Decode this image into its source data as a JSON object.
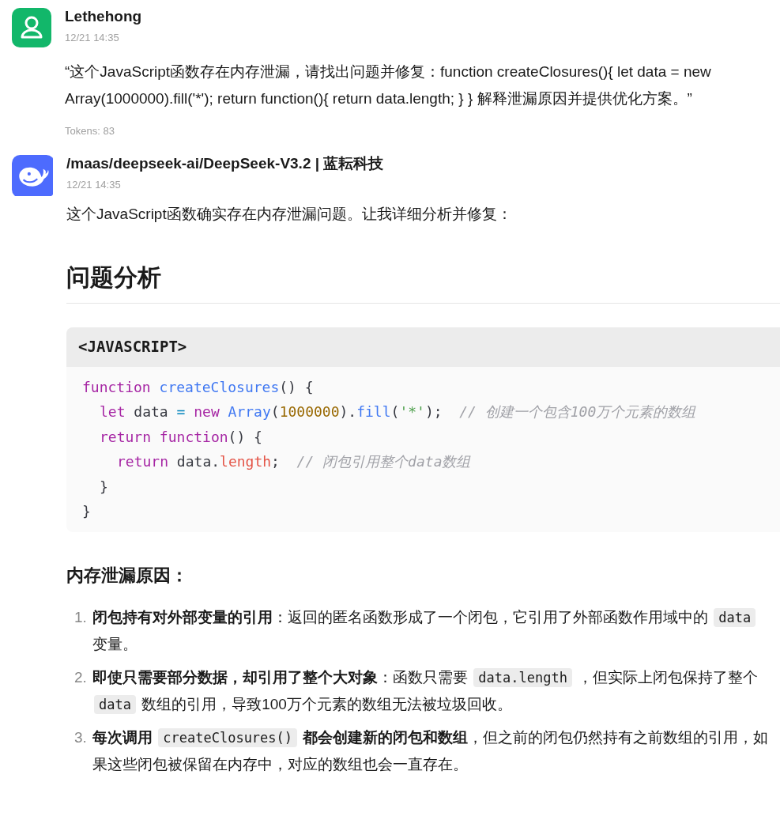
{
  "messages": [
    {
      "kind": "user",
      "author": "Lethehong",
      "time": "12/21 14:35",
      "text": "“这个JavaScript函数存在内存泄漏，请找出问题并修复：function createClosures(){ let data = new Array(1000000).fill('*'); return function(){ return data.length; } } 解释泄漏原因并提供优化方案。”",
      "tokens": "Tokens: 83"
    },
    {
      "kind": "bot",
      "author": "/maas/deepseek-ai/DeepSeek-V3.2 | 蓝耘科技",
      "time": "12/21 14:35",
      "intro": "这个JavaScript函数确实存在内存泄漏问题。让我详细分析并修复：",
      "heading": "问题分析",
      "code": {
        "language": "<JAVASCRIPT>",
        "lines": [
          {
            "tokens": [
              {
                "kind": "keyword",
                "text": "function"
              },
              {
                "kind": "func",
                "text": " createClosures"
              },
              {
                "kind": "plain",
                "text": "() {"
              }
            ],
            "children": [
              {
                "tokens": [
                  {
                    "kind": "keyword",
                    "text": "let"
                  },
                  {
                    "kind": "plain",
                    "text": " data "
                  },
                  {
                    "kind": "operator",
                    "text": "="
                  },
                  {
                    "kind": "keyword",
                    "text": " new"
                  },
                  {
                    "kind": "func",
                    "text": " Array"
                  },
                  {
                    "kind": "plain",
                    "text": "("
                  },
                  {
                    "kind": "number",
                    "text": "1000000"
                  },
                  {
                    "kind": "plain",
                    "text": ")."
                  },
                  {
                    "kind": "func",
                    "text": "fill"
                  },
                  {
                    "kind": "plain",
                    "text": "("
                  },
                  {
                    "kind": "string",
                    "text": "'*'"
                  },
                  {
                    "kind": "plain",
                    "text": ");  "
                  },
                  {
                    "kind": "comment",
                    "text": "// 创建一个包含100万个元素的数组"
                  }
                ]
              },
              {
                "tokens": [
                  {
                    "kind": "keyword",
                    "text": "return"
                  },
                  {
                    "kind": "keyword",
                    "text": " function"
                  },
                  {
                    "kind": "plain",
                    "text": "() {"
                  }
                ],
                "children": [
                  {
                    "tokens": [
                      {
                        "kind": "keyword",
                        "text": "return"
                      },
                      {
                        "kind": "plain",
                        "text": " data."
                      },
                      {
                        "kind": "property",
                        "text": "length"
                      },
                      {
                        "kind": "plain",
                        "text": ";  "
                      },
                      {
                        "kind": "comment",
                        "text": "// 闭包引用整个data数组"
                      }
                    ]
                  }
                ]
              },
              {
                "tokens": [
                  {
                    "kind": "plain",
                    "text": "}"
                  }
                ]
              }
            ]
          },
          {
            "tokens": [
              {
                "kind": "plain",
                "text": "}"
              }
            ]
          }
        ]
      },
      "subheading": "内存泄漏原因：",
      "list": [
        {
          "number": "1.",
          "parts": [
            {
              "kind": "bold",
              "text": "闭包持有对外部变量的引用"
            },
            {
              "kind": "text",
              "text": "：返回的匿名函数形成了一个闭包，它引用了外部函数作用域中的 "
            },
            {
              "kind": "code",
              "text": "data"
            },
            {
              "kind": "text",
              "text": " 变量。"
            }
          ]
        },
        {
          "number": "2.",
          "parts": [
            {
              "kind": "bold",
              "text": "即使只需要部分数据，却引用了整个大对象"
            },
            {
              "kind": "text",
              "text": "：函数只需要 "
            },
            {
              "kind": "code",
              "text": "data.length"
            },
            {
              "kind": "text",
              "text": " ，但实际上闭包保持了整个 "
            },
            {
              "kind": "code",
              "text": "data"
            },
            {
              "kind": "text",
              "text": " 数组的引用，导致100万个元素的数组无法被垃圾回收。"
            }
          ]
        },
        {
          "number": "3.",
          "parts": [
            {
              "kind": "bold",
              "text": "每次调用 "
            },
            {
              "kind": "code",
              "text": "createClosures()"
            },
            {
              "kind": "bold",
              "text": " 都会创建新的闭包和数组"
            },
            {
              "kind": "text",
              "text": "，但之前的闭包仍然持有之前数组的引用，如果这些闭包被保留在内存中，对应的数组也会一直存在。"
            }
          ]
        }
      ]
    }
  ]
}
